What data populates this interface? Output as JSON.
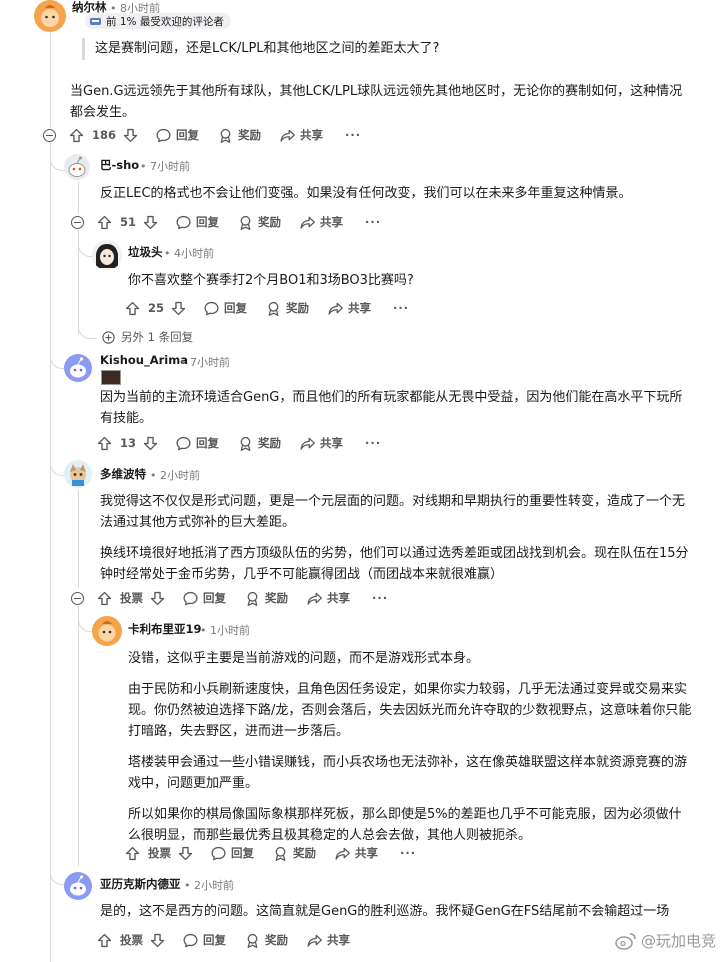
{
  "comments": [
    {
      "id": "c1",
      "author": "纳尔林",
      "time": "• 8小时前",
      "badge": "前 1% 最受欢迎的评论者",
      "quote": "这是赛制问题，还是LCK/LPL和其他地区之间的差距太大了?",
      "paragraphs": [
        "当Gen.G远远领先于其他所有球队，其他LCK/LPL球队远远领先其他地区时，无论你的赛制如何，这种情况都会发生。"
      ],
      "votes": "186"
    },
    {
      "id": "c2",
      "author": "巴-sho",
      "time": "• 7小时前",
      "paragraphs": [
        "反正LEC的格式也不会让他们变强。如果没有任何改变，我们可以在未来多年重复这种情景。"
      ],
      "votes": "51"
    },
    {
      "id": "c3",
      "author": "垃圾头",
      "time": "• 4小时前",
      "paragraphs": [
        "你不喜欢整个赛季打2个月BO1和3场BO3比赛吗?"
      ],
      "votes": "25"
    },
    {
      "id": "c4",
      "author": "Kishou_Arima",
      "time": "• 7小时前",
      "paragraphs": [
        "因为当前的主流环境适合GenG，而且他们的所有玩家都能从无畏中受益，因为他们能在高水平下玩所有技能。"
      ],
      "votes": "13"
    },
    {
      "id": "c5",
      "author": "多维波特",
      "time": "• 2小时前",
      "paragraphs": [
        "我觉得这不仅仅是形式问题，更是一个元层面的问题。对线期和早期执行的重要性转变，造成了一个无法通过其他方式弥补的巨大差距。",
        "换线环境很好地抵消了西方顶级队伍的劣势，他们可以通过选秀差距或团战找到机会。现在队伍在15分钟时经常处于金币劣势，几乎不可能赢得团战（而团战本来就很难赢）"
      ],
      "votes": "投票"
    },
    {
      "id": "c6",
      "author": "卡利布里亚19",
      "time": "• 1小时前",
      "paragraphs": [
        "没错，这似乎主要是当前游戏的问题，而不是游戏形式本身。",
        "由于民防和小兵刷新速度快，且角色因任务设定，如果你实力较弱，几乎无法通过变异或交易来实现。你仍然被迫选择下路/龙，否则会落后，失去因妖光而允许夺取的少数视野点，这意味着你只能打暗路，失去野区，进而进一步落后。",
        "塔楼装甲会通过一些小错误赚钱，而小兵农场也无法弥补，这在像英雄联盟这样本就资源竞赛的游戏中，问题更加严重。",
        "所以如果你的棋局像国际象棋那样死板，那么即使是5%的差距也几乎不可能克服，因为必须做什么很明显，而那些最优秀且极其稳定的人总会去做，其他人则被扼杀。"
      ],
      "votes": "投票"
    },
    {
      "id": "c7",
      "author": "亚历克斯内德亚",
      "time": "• 2小时前",
      "paragraphs": [
        "是的，这不是西方的问题。这简直就是GenG的胜利巡游。我怀疑GenG在FS结尾前不会输超过一场"
      ],
      "votes": "投票"
    }
  ],
  "actions": {
    "reply": "回复",
    "award": "奖励",
    "share": "共享",
    "more": "···"
  },
  "more_replies": "另外 1 条回复",
  "watermark": "@玩加电竞",
  "colors": {
    "text": "#1a1a1b",
    "muted": "#7c7c7c",
    "line": "#d7dadc",
    "action": "#57595c"
  }
}
